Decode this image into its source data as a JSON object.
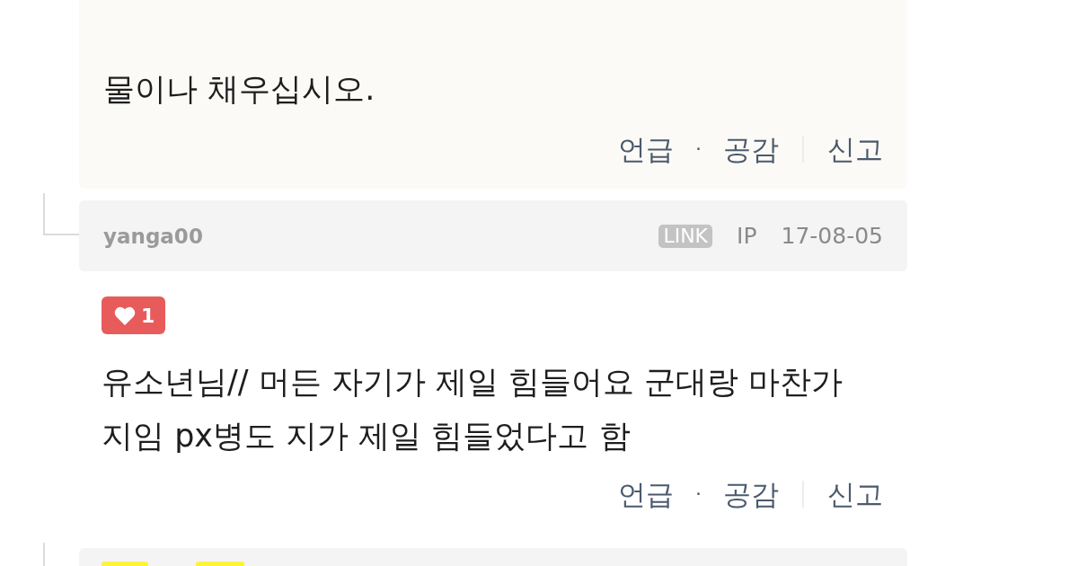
{
  "thread": {
    "top_comment": {
      "body_lines": [
        "물이나 채우십시오."
      ],
      "actions": [
        {
          "kind": "link",
          "label": "언급"
        },
        {
          "kind": "separator",
          "label": "·"
        },
        {
          "kind": "link",
          "label": "공감"
        },
        {
          "kind": "divider"
        },
        {
          "kind": "link",
          "label": "신고"
        }
      ]
    },
    "replies": [
      {
        "author": "yanga00",
        "badge": "LINK",
        "ip": "IP",
        "date": "17-08-05",
        "likes": "1",
        "body_lines": [
          "유소년님// 머든 자기가 제일 힘들어요 군대랑 마찬가",
          "지임 px병도 지가 제일 힘들었다고 함"
        ],
        "actions": [
          {
            "kind": "link",
            "label": "언급"
          },
          {
            "kind": "separator",
            "label": "·"
          },
          {
            "kind": "link",
            "label": "공감"
          },
          {
            "kind": "divider"
          },
          {
            "kind": "link",
            "label": "신고"
          }
        ]
      }
    ]
  }
}
